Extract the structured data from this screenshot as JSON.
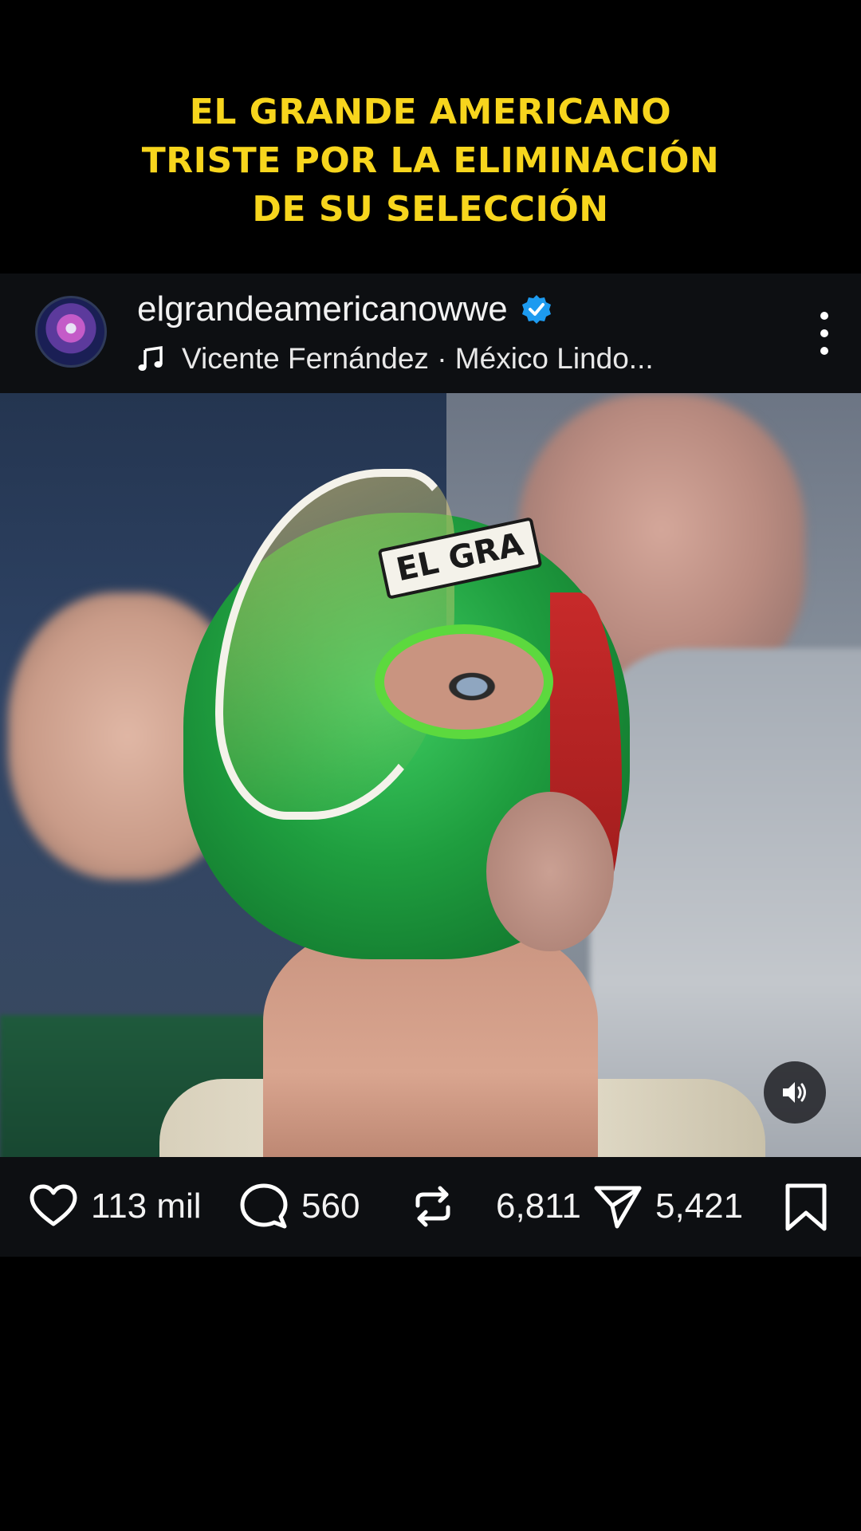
{
  "headline": {
    "line1": "EL GRANDE AMERICANO",
    "line2": "TRISTE POR LA ELIMINACIÓN",
    "line3": "DE SU SELECCIÓN"
  },
  "post": {
    "username": "elgrandeamericanowwe",
    "verified": true,
    "music": "Vicente Fernández · México Lindo...",
    "mask_text": "EL GRA"
  },
  "actions": {
    "likes": "113 mil",
    "comments": "560",
    "reposts": "6,811",
    "shares": "5,421"
  },
  "colors": {
    "headline": "#f7d51d",
    "verified": "#1d9bf0",
    "bar_background": "#0d0f12"
  },
  "icons": [
    "music-note-icon",
    "verified-badge-icon",
    "more-options-icon",
    "sound-icon",
    "heart-icon",
    "comment-icon",
    "repost-icon",
    "send-icon",
    "bookmark-icon"
  ]
}
